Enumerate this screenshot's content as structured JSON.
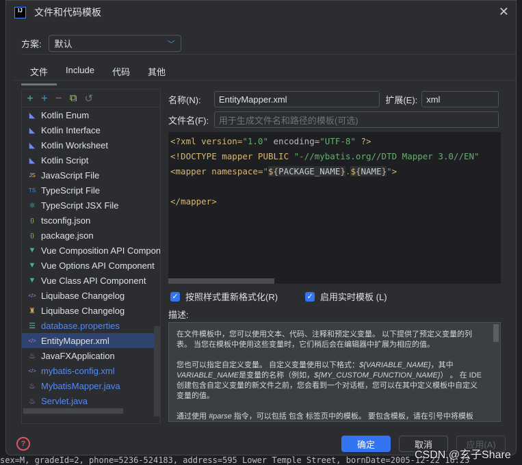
{
  "background_text": "sex=M, gradeId=2, phone=5236-524183, address=595 Lower Temple Street, bornDate=2005-12-22 16:23",
  "window": {
    "title": "文件和代码模板",
    "logo": "IJ"
  },
  "scheme": {
    "label": "方案:",
    "value": "默认"
  },
  "tabs": [
    {
      "label": "文件",
      "active": true
    },
    {
      "label": "Include"
    },
    {
      "label": "代码"
    },
    {
      "label": "其他"
    }
  ],
  "toolbar": [
    "add-icon",
    "add-child-icon",
    "remove-icon",
    "copy-icon",
    "reset-icon"
  ],
  "templates": [
    {
      "label": "Kotlin Enum",
      "icon": "kotlin-icon"
    },
    {
      "label": "Kotlin Interface",
      "icon": "kotlin-icon"
    },
    {
      "label": "Kotlin Worksheet",
      "icon": "kotlin-icon"
    },
    {
      "label": "Kotlin Script",
      "icon": "kotlin-icon"
    },
    {
      "label": "JavaScript File",
      "icon": "javascript-icon"
    },
    {
      "label": "TypeScript File",
      "icon": "typescript-icon"
    },
    {
      "label": "TypeScript JSX File",
      "icon": "react-icon"
    },
    {
      "label": "tsconfig.json",
      "icon": "json-icon"
    },
    {
      "label": "package.json",
      "icon": "json-icon"
    },
    {
      "label": "Vue Composition API Component",
      "icon": "vue-icon"
    },
    {
      "label": "Vue Options API Component",
      "icon": "vue-icon"
    },
    {
      "label": "Vue Class API Component",
      "icon": "vue-icon"
    },
    {
      "label": "Liquibase Changelog",
      "icon": "xml-icon"
    },
    {
      "label": "Liquibase Changelog",
      "icon": "yaml-icon"
    },
    {
      "label": "database.properties",
      "icon": "properties-icon",
      "modified": true
    },
    {
      "label": "EntityMapper.xml",
      "icon": "xml-icon",
      "selected": true
    },
    {
      "label": "JavaFXApplication",
      "icon": "java-icon"
    },
    {
      "label": "mybatis-config.xml",
      "icon": "xml-icon",
      "modified": true
    },
    {
      "label": "MybatisMapper.java",
      "icon": "java-icon",
      "modified": true
    },
    {
      "label": "Servlet.java",
      "icon": "java-icon",
      "modified": true
    }
  ],
  "form": {
    "name_label": "名称(N):",
    "name_value": "EntityMapper.xml",
    "ext_label": "扩展(E):",
    "ext_value": "xml",
    "filename_label": "文件名(F):",
    "filename_placeholder": "用于生成文件名和路径的模板(可选)"
  },
  "code": {
    "l1": [
      "<?xml version=",
      "\"1.0\"",
      " encoding=",
      "\"UTF-8\"",
      " ?>"
    ],
    "l2": [
      "<!DOCTYPE mapper PUBLIC ",
      "\"-//mybatis.org//DTD Mapper 3.0//EN\""
    ],
    "l3": [
      "<mapper namespace=",
      "\"",
      "${",
      "PACKAGE_NAME",
      "}",
      ".",
      "${",
      "NAME",
      "}",
      "\"",
      ">"
    ],
    "l5": "</mapper>"
  },
  "options": {
    "reformat": {
      "label": "按照样式重新格式化(R)",
      "checked": true
    },
    "live_templates": {
      "label": "启用实时模板 (L)",
      "checked": true
    }
  },
  "description": {
    "label": "描述:",
    "p1": "在文件模板中，您可以使用文本、代码、注释和预定义变量。 以下提供了预定义变量的列表。 当您在模板中使用这些变量时，它们稍后会在编辑器中扩展为相应的值。",
    "p2a": "您也可以指定自定义变量。 自定义变量使用以下格式：",
    "p2b": "${VARIABLE_NAME}",
    "p2c": "，其中 ",
    "p2d": "VARIABLE_NAME",
    "p2e": "是变量的名称（例如，",
    "p2f": "${MY_CUSTOM_FUNCTION_NAME}",
    "p2g": "） 。 在 IDE 创建包含自定义变量的新文件之前，您会看到一个对话框，您可以在其中定义模板中自定义变量的值。",
    "p3a": "通过使用 ",
    "p3b": "#parse",
    "p3c": " 指令，可以包括 包含 标签页中的模板。 要包含模板，请在引号中将模板"
  },
  "buttons": {
    "ok": "确定",
    "cancel": "取消",
    "apply": "应用(A)"
  },
  "watermark": "CSDN @玄子Share",
  "colors": {
    "accent": "#3574f0",
    "selection": "#2e436e",
    "modified": "#548af7"
  }
}
